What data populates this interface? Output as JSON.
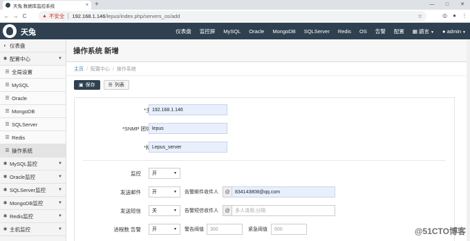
{
  "browser": {
    "tab_title": "天兔 数据库监控系统",
    "tab_close": "×",
    "new_tab": "+",
    "win_controls": [
      "—",
      "□",
      "✕"
    ],
    "nav": [
      "←",
      "→",
      "C"
    ],
    "security_label": "不安全",
    "url_host": "192.168.1.146",
    "url_path": "/lepus/index.php/servers_os/add",
    "star": "☆"
  },
  "app": {
    "brand": "天兔",
    "nav": [
      "仪表盘",
      "监控屏",
      "MySQL",
      "Oracle",
      "MongoDB",
      "SQLServer",
      "Redis",
      "OS",
      "告警",
      "配置"
    ],
    "language": "語言",
    "user": "admin"
  },
  "sidebar": {
    "items": [
      {
        "label": "仪表盘",
        "icon": "dashboard-icon",
        "type": "top"
      },
      {
        "label": "配置中心",
        "icon": "settings-icon",
        "type": "group"
      },
      {
        "label": "全局设置",
        "icon": "list-icon",
        "type": "sub"
      },
      {
        "label": "MySQL",
        "icon": "list-icon",
        "type": "sub"
      },
      {
        "label": "Oracle",
        "icon": "list-icon",
        "type": "sub"
      },
      {
        "label": "MongoDB",
        "icon": "list-icon",
        "type": "sub"
      },
      {
        "label": "SQLServer",
        "icon": "list-icon",
        "type": "sub"
      },
      {
        "label": "Redis",
        "icon": "list-icon",
        "type": "sub"
      },
      {
        "label": "操作系统",
        "icon": "list-icon",
        "type": "sub-active"
      },
      {
        "label": "MySQL监控",
        "icon": "settings-icon",
        "type": "group"
      },
      {
        "label": "Oracle监控",
        "icon": "settings-icon",
        "type": "group"
      },
      {
        "label": "SQLServer监控",
        "icon": "settings-icon",
        "type": "group"
      },
      {
        "label": "MongoDB监控",
        "icon": "settings-icon",
        "type": "group"
      },
      {
        "label": "Redis监控",
        "icon": "settings-icon",
        "type": "group"
      },
      {
        "label": "主机监控",
        "icon": "settings-icon",
        "type": "group"
      }
    ]
  },
  "page": {
    "title": "操作系统 新增",
    "breadcrumb": [
      "主页",
      "配置中心",
      "操作系统"
    ],
    "save_label": "保存",
    "list_label": "列表"
  },
  "form": {
    "host_label": "*主机",
    "host_value": "192.168.1.146",
    "snmp_label": "*SNMP 团体名",
    "snmp_value": "lepus",
    "tag_label": "*标签",
    "tag_value": "Lepus_server",
    "monitor_label": "监控",
    "monitor_value": "开",
    "mail_label": "发送邮件",
    "mail_value": "开",
    "mail_recv_label": "告警邮件收件人",
    "mail_recv_value": "834143808@qq.com",
    "sms_label": "发送短信",
    "sms_value": "关",
    "sms_recv_label": "告警短信收件人",
    "sms_recv_placeholder": "多人请用;分隔",
    "proc_label": "进程数 告警",
    "proc_value": "开",
    "warn_label": "警告阈值",
    "warn_placeholder": "300",
    "crit_label": "紧急阈值",
    "crit_placeholder": "500",
    "at_sign": "@"
  },
  "watermark": "@51CTO博客"
}
